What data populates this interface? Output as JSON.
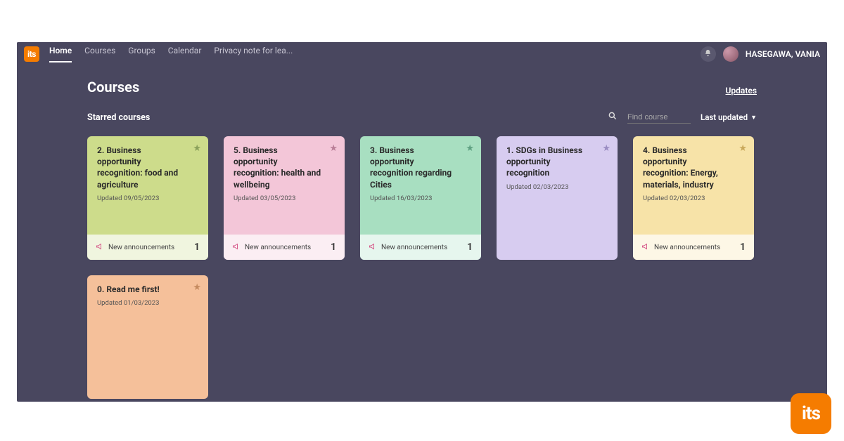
{
  "brand": "its",
  "nav": {
    "items": [
      {
        "label": "Home",
        "active": true
      },
      {
        "label": "Courses",
        "active": false
      },
      {
        "label": "Groups",
        "active": false
      },
      {
        "label": "Calendar",
        "active": false
      },
      {
        "label": "Privacy note for lea...",
        "active": false
      }
    ]
  },
  "user": {
    "name": "HASEGAWA, VANIA"
  },
  "page": {
    "title": "Courses",
    "updates_label": "Updates",
    "section_title": "Starred courses"
  },
  "search": {
    "placeholder": "Find course"
  },
  "sort": {
    "label": "Last updated"
  },
  "announcements_label": "New announcements",
  "courses": [
    {
      "title": "2. Business opportunity recognition: food and agriculture",
      "updated": "Updated 09/05/2023",
      "color": "green",
      "announcements": "1"
    },
    {
      "title": "5. Business opportunity recognition: health and wellbeing",
      "updated": "Updated 03/05/2023",
      "color": "pink",
      "announcements": "1"
    },
    {
      "title": "3. Business opportunity recognition regarding Cities",
      "updated": "Updated 16/03/2023",
      "color": "teal",
      "announcements": "1"
    },
    {
      "title": "1. SDGs in Business opportunity recognition",
      "updated": "Updated 02/03/2023",
      "color": "purple",
      "announcements": null
    },
    {
      "title": "4. Business opportunity recognition: Energy, materials, industry",
      "updated": "Updated 02/03/2023",
      "color": "yellow",
      "announcements": "1"
    },
    {
      "title": "0. Read me first!",
      "updated": "Updated 01/03/2023",
      "color": "orange",
      "announcements": null
    }
  ],
  "badge_text": "its"
}
